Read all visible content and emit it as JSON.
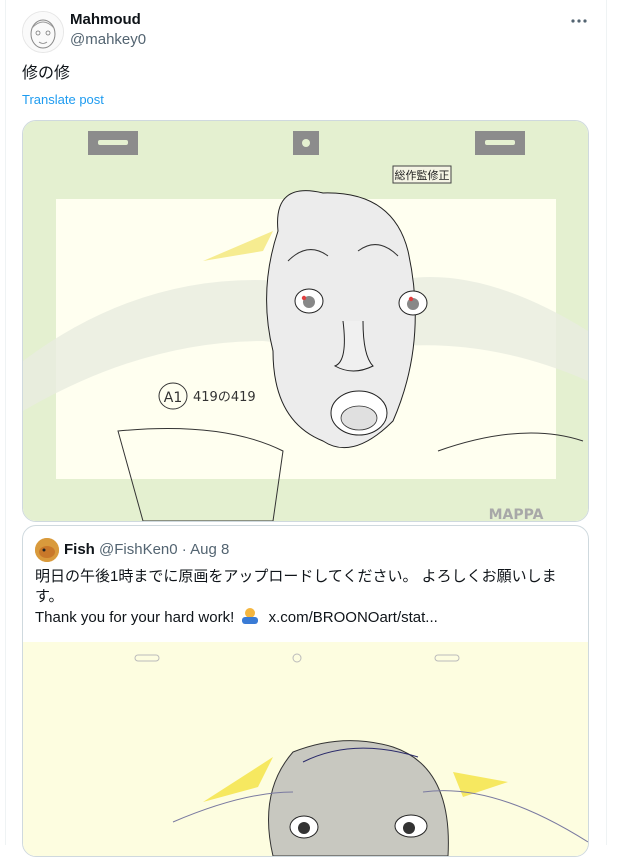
{
  "post": {
    "author_name": "Mahmoud",
    "author_handle": "@mahkey0",
    "text": "修の修",
    "translate_label": "Translate post",
    "more_icon": "more-icon"
  },
  "media": {
    "stamp_text": "総作監修正",
    "cut_label": "A1",
    "cut_number": "419の419",
    "watermark": "MAPPA",
    "colors": {
      "frame": "#e4f0d0",
      "sheet": "#fffff0",
      "peg": "#8c8c8c"
    }
  },
  "quote": {
    "author_name": "Fish",
    "author_handle": "@FishKen0",
    "separator": "·",
    "date": "Aug 8",
    "text_ja": "明日の午後1時までに原画をアップロードしてください。 よろしくお願いします。",
    "text_en": "Thank you for your hard work!",
    "link": "x.com/BROONOart/stat...",
    "emoji_icon": "bowing-person-icon"
  }
}
